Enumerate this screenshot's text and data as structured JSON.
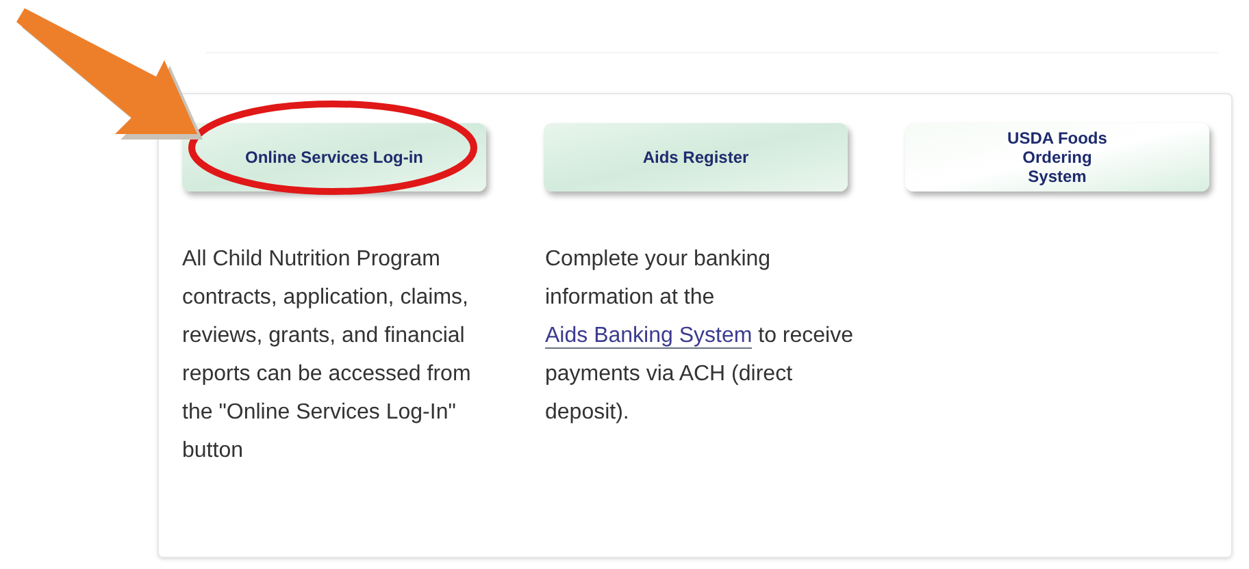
{
  "pointer_arrow": true,
  "buttons": [
    {
      "label": "Online Services Log-in",
      "circled": true
    },
    {
      "label": "Aids Register",
      "circled": false
    },
    {
      "label": "USDA Foods Ordering System",
      "circled": false
    }
  ],
  "descriptions": [
    {
      "text": "All Child Nutrition Program contracts, application, claims, reviews, grants, and financial reports can be accessed from the \"Online Services Log-In\" button"
    },
    {
      "before": "Complete your banking information at the",
      "link": "Aids Banking System",
      "after": "to receive payments via ACH (direct deposit)."
    }
  ]
}
